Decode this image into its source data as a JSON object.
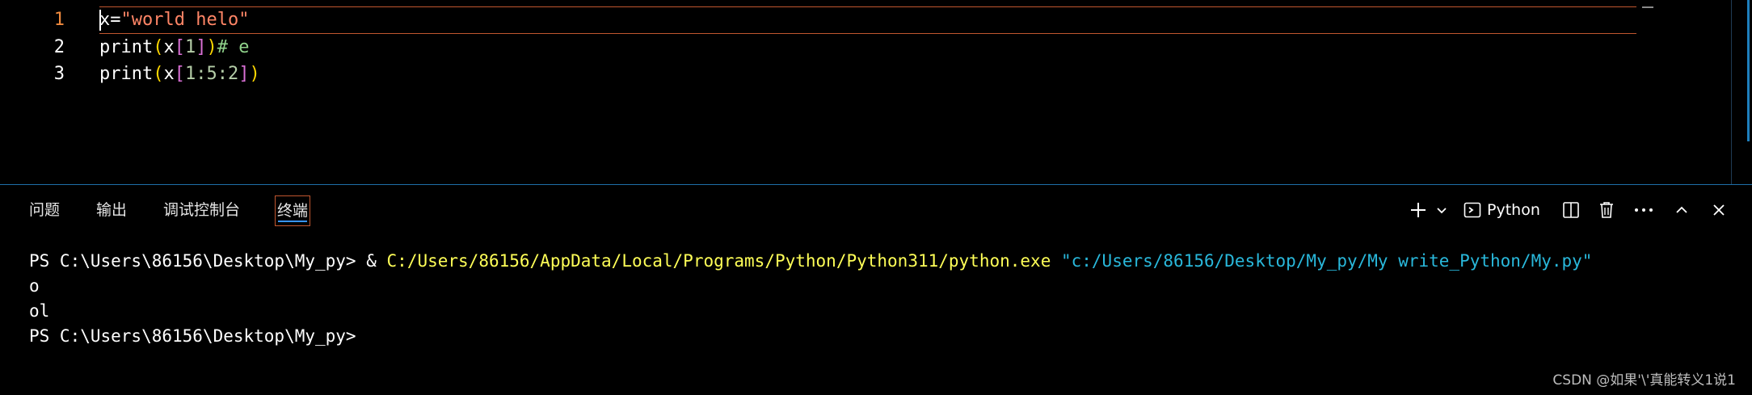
{
  "editor": {
    "lines": [
      {
        "number": "1",
        "tokens": [
          {
            "t": "x",
            "c": "ident"
          },
          {
            "t": "=",
            "c": "op"
          },
          {
            "t": "\"world helo\"",
            "c": "str"
          }
        ]
      },
      {
        "number": "2",
        "tokens": [
          {
            "t": "print",
            "c": "ident"
          },
          {
            "t": "(",
            "c": "paren"
          },
          {
            "t": "x",
            "c": "ident"
          },
          {
            "t": "[",
            "c": "brack"
          },
          {
            "t": "1",
            "c": "num"
          },
          {
            "t": "]",
            "c": "brack"
          },
          {
            "t": ")",
            "c": "paren"
          },
          {
            "t": "# e",
            "c": "comment"
          }
        ]
      },
      {
        "number": "3",
        "tokens": [
          {
            "t": "print",
            "c": "ident"
          },
          {
            "t": "(",
            "c": "paren"
          },
          {
            "t": "x",
            "c": "ident"
          },
          {
            "t": "[",
            "c": "brack"
          },
          {
            "t": "1:5:2",
            "c": "num"
          },
          {
            "t": "]",
            "c": "brack"
          },
          {
            "t": ")",
            "c": "paren"
          }
        ]
      }
    ]
  },
  "panel": {
    "tabs": [
      {
        "label": "问题",
        "active": false
      },
      {
        "label": "输出",
        "active": false
      },
      {
        "label": "调试控制台",
        "active": false
      },
      {
        "label": "终端",
        "active": true
      }
    ],
    "actions": {
      "new_terminal_icon": "plus-icon",
      "dropdown_icon": "chevron-down-icon",
      "terminal_profile_label": "Python",
      "split_icon": "split-icon",
      "kill_icon": "trash-icon",
      "more_icon": "ellipsis-icon",
      "maximize_icon": "chevron-up-icon",
      "close_icon": "close-icon"
    }
  },
  "terminal": {
    "lines": [
      {
        "prompt": "PS C:\\Users\\86156\\Desktop\\My_py> ",
        "amp": "& ",
        "exe": "C:/Users/86156/AppData/Local/Programs/Python/Python311/python.exe",
        "arg": " \"c:/Users/86156/Desktop/My_py/My write_Python/My.py\""
      },
      {
        "output": "o"
      },
      {
        "output": "ol"
      },
      {
        "prompt": "PS C:\\Users\\86156\\Desktop\\My_py>"
      }
    ]
  },
  "watermark": "CSDN @如果'\\'真能转义1说1",
  "colors": {
    "accent_border": "#c0562f",
    "active_tab_underline": "#3794ff",
    "string": "#ff8566",
    "bracket_paren": "#ffd700",
    "bracket_square": "#da70d6",
    "exe_path": "#ffff57",
    "arg_path": "#29b8db"
  }
}
